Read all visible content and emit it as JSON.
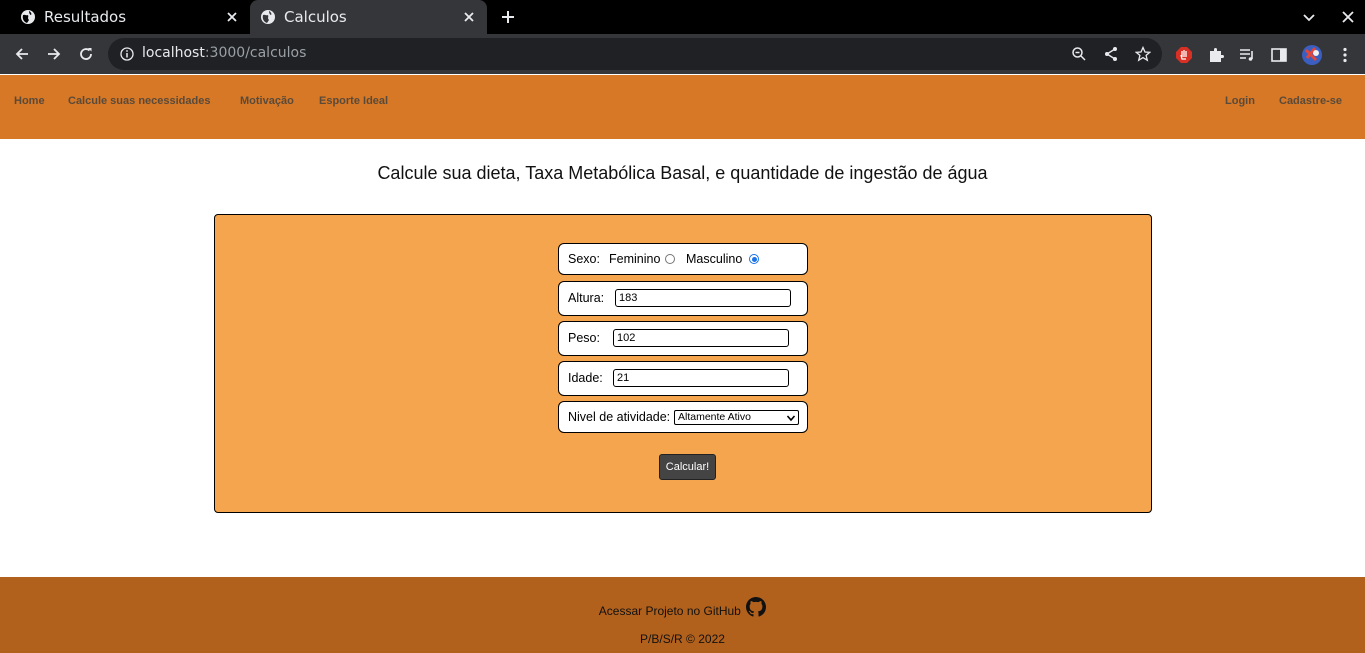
{
  "browser": {
    "tabs": [
      {
        "title": "Resultados",
        "active": false
      },
      {
        "title": "Calculos",
        "active": true
      }
    ],
    "url_host": "localhost",
    "url_path": ":3000/calculos"
  },
  "site_nav": {
    "left": [
      "Home",
      "Calcule suas necessidades",
      "Motivação",
      "Esporte Ideal"
    ],
    "right": [
      "Login",
      "Cadastre-se"
    ]
  },
  "page_title": "Calcule sua dieta, Taxa Metabólica Basal, e quantidade de ingestão de água",
  "form": {
    "sexo_label": "Sexo:",
    "feminino_label": "Feminino",
    "masculino_label": "Masculino",
    "selected_sex": "Masculino",
    "altura_label": "Altura:",
    "altura_value": "183",
    "peso_label": "Peso:",
    "peso_value": "102",
    "idade_label": "Idade:",
    "idade_value": "21",
    "atividade_label": "Nivel de atividade:",
    "atividade_value": "Altamente Ativo",
    "submit_label": "Calcular!"
  },
  "footer": {
    "github_text": "Acessar Projeto no GitHub",
    "copyright": "P/B/S/R © 2022"
  },
  "colors": {
    "nav_bg": "#d67826",
    "panel_bg": "#f4a54d",
    "footer_bg": "#b2611d",
    "button_bg": "#444444"
  }
}
